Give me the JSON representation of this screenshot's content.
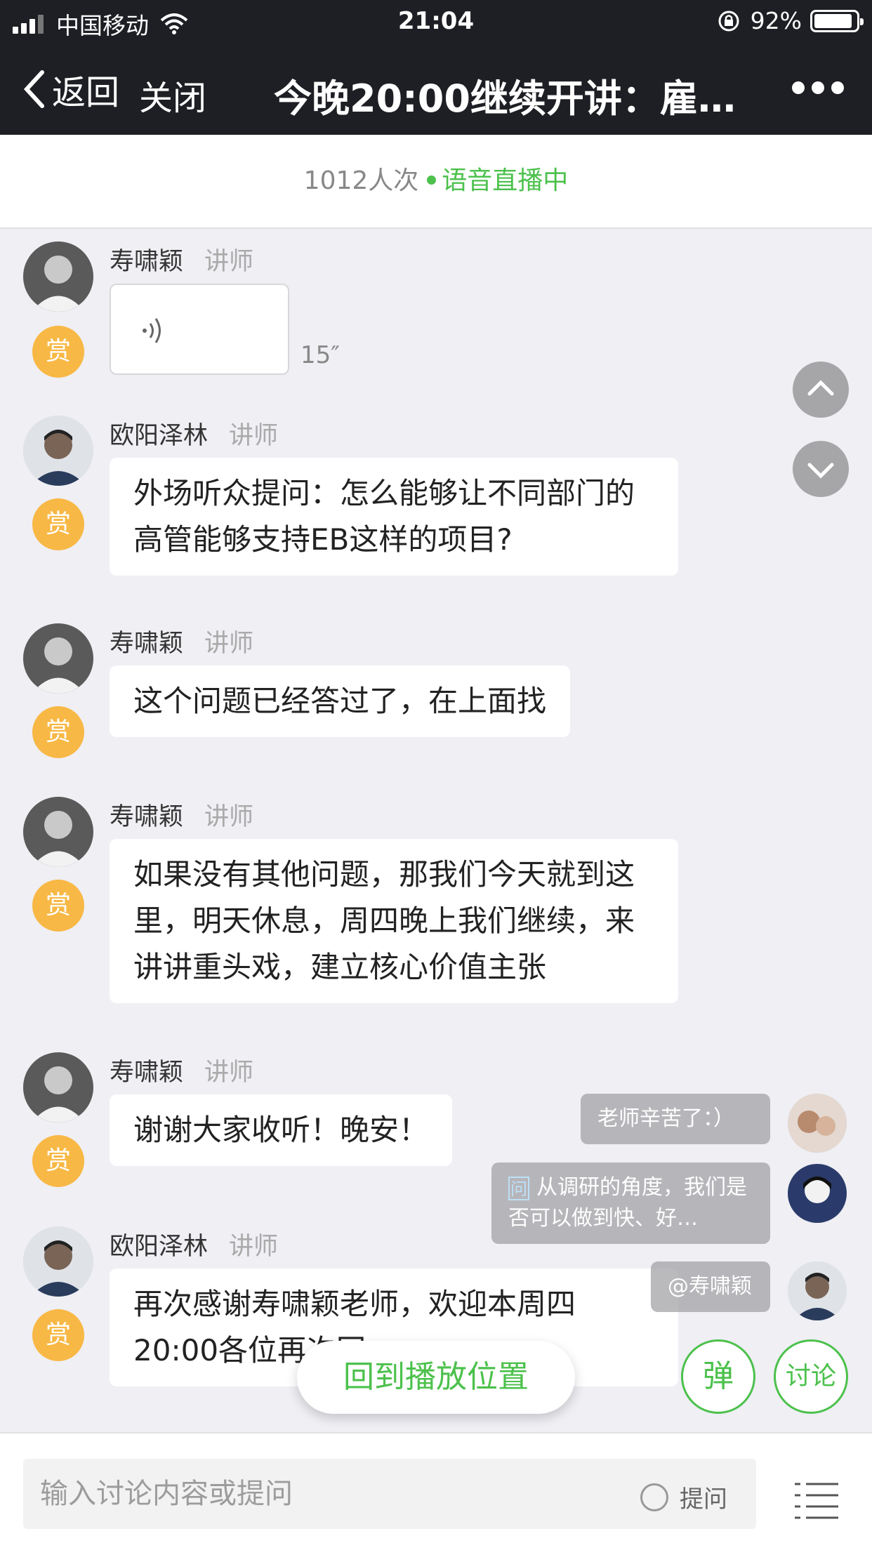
{
  "status_bar": {
    "carrier": "中国移动",
    "time": "21:04",
    "battery_percent": "92%",
    "battery_level": 0.92
  },
  "nav": {
    "back_label": "返回",
    "close_label": "关闭",
    "title": "今晚20:00继续开讲：雇…"
  },
  "live": {
    "viewers": "1012人次",
    "status": "语音直播中"
  },
  "messages": [
    {
      "sender": "寿啸颖",
      "role": "讲师",
      "type": "voice",
      "duration": "15″",
      "reward": "赏"
    },
    {
      "sender": "欧阳泽林",
      "role": "讲师",
      "type": "text",
      "text": "外场听众提问：怎么能够让不同部门的高管能够支持EB这样的项目?",
      "reward": "赏"
    },
    {
      "sender": "寿啸颖",
      "role": "讲师",
      "type": "text",
      "text": "这个问题已经答过了，在上面找",
      "reward": "赏"
    },
    {
      "sender": "寿啸颖",
      "role": "讲师",
      "type": "text",
      "text": "如果没有其他问题，那我们今天就到这里，明天休息，周四晚上我们继续，来讲讲重头戏，建立核心价值主张",
      "reward": "赏"
    },
    {
      "sender": "寿啸颖",
      "role": "讲师",
      "type": "text",
      "text": "谢谢大家收听！晚安！",
      "reward": "赏"
    },
    {
      "sender": "欧阳泽林",
      "role": "讲师",
      "type": "text",
      "text": "再次感谢寿啸颖老师，欢迎本周四20:00各位再次回",
      "reward": "赏"
    }
  ],
  "danmaku": [
    {
      "text": "老师辛苦了：）"
    },
    {
      "tag": "问",
      "text": "从调研的角度，我们是否可以做到快、好…"
    },
    {
      "text": "@寿啸颖"
    }
  ],
  "controls": {
    "back_to_play": "回到播放位置",
    "danmu_toggle": "弹",
    "discuss": "讨论"
  },
  "input": {
    "placeholder": "输入讨论内容或提问",
    "ask_label": "提问"
  },
  "colors": {
    "header_bg": "#1e1f24",
    "accent_green": "#4cc14c",
    "reward_yellow": "#f8b845",
    "page_bg": "#efeff4"
  }
}
